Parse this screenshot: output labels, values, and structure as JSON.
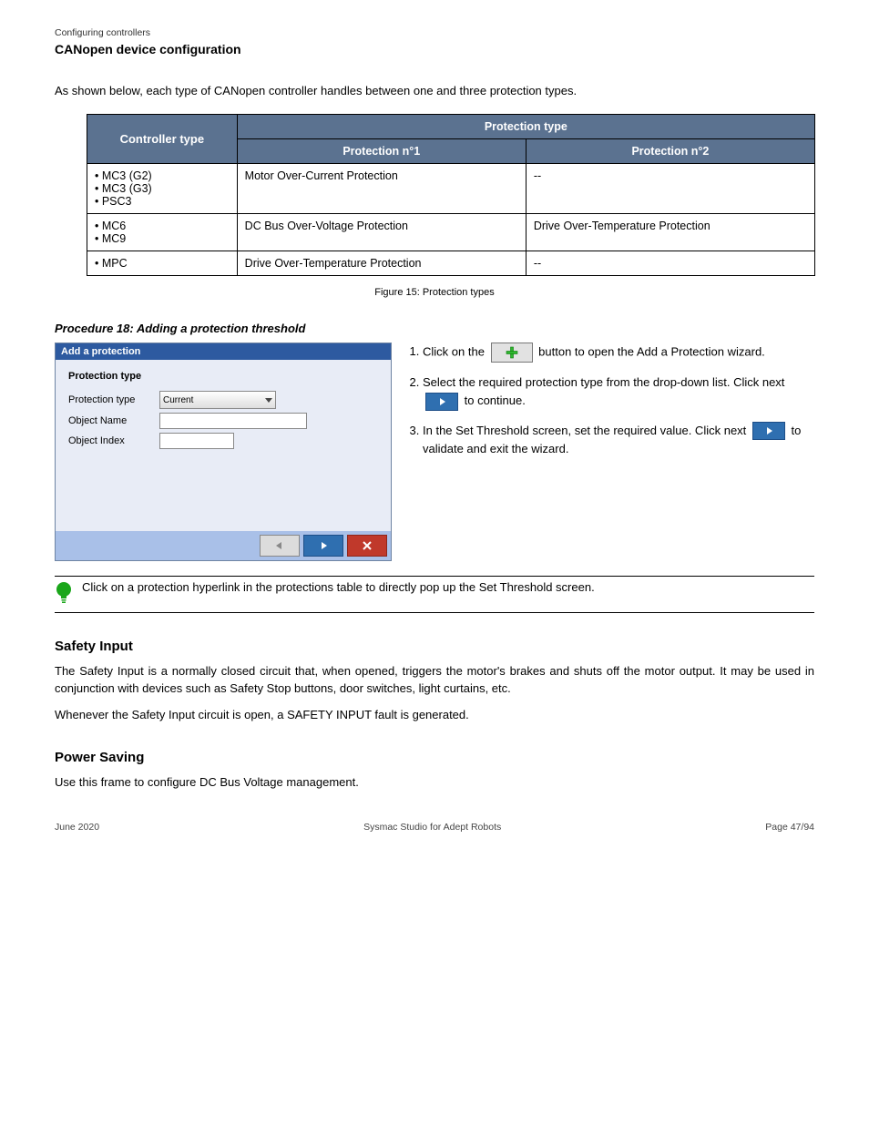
{
  "header": {
    "doc_line": "Configuring controllers",
    "section_line": "CANopen device configuration"
  },
  "intro_text": "As shown below, each type of CANopen controller handles between one and three protection types.",
  "table": {
    "header_corner": "Controller type",
    "header_span": "Protection type",
    "col1": "Protection n°1",
    "col2": "Protection n°2",
    "rows": [
      {
        "type": "• MC3 (G2)\n• MC3 (G3)\n• PSC3",
        "p1": "Motor Over-Current Protection",
        "p2": "--"
      },
      {
        "type": "• MC6\n• MC9",
        "p1": "DC Bus Over-Voltage Protection",
        "p2": "Drive Over-Temperature Protection"
      },
      {
        "type": "• MPC",
        "p1": "Drive Over-Temperature Protection",
        "p2": "--"
      }
    ]
  },
  "table_caption": "Figure 15: Protection types",
  "procedure": {
    "title": "Procedure 18: Adding a protection threshold",
    "wizard": {
      "title": "Add a protection",
      "subtitle": "Protection type",
      "field1_label": "Protection type",
      "field2_label": "Object Name",
      "field3_label": "Object Index",
      "select_value": "Current"
    },
    "step1_a": "Click on the ",
    "step1_b": " button to open the Add a Protection wizard.",
    "step2_a": "Select the required protection type from the drop-down list. Click next ",
    "step2_b": " to continue.",
    "step3_a": "In the Set Threshold screen, set the required value. Click next ",
    "step3_b": " to validate and exit the wizard."
  },
  "tip": "Click on a protection hyperlink in the protections table to directly pop up the Set Threshold screen.",
  "safety_input": {
    "heading": "Safety Input",
    "p1": "The Safety Input is a normally closed circuit that, when opened, triggers the motor's brakes and shuts off the motor output. It may be used in conjunction with devices such as Safety Stop buttons, door switches, light curtains, etc.",
    "p2": "Whenever the Safety Input circuit is open, a SAFETY INPUT fault is generated."
  },
  "power_saving": {
    "heading": "Power Saving",
    "p1": "Use this frame to configure DC Bus Voltage management."
  },
  "footer": {
    "left": "June 2020",
    "center": "Sysmac Studio for Adept Robots",
    "right": "Page 47/94"
  }
}
